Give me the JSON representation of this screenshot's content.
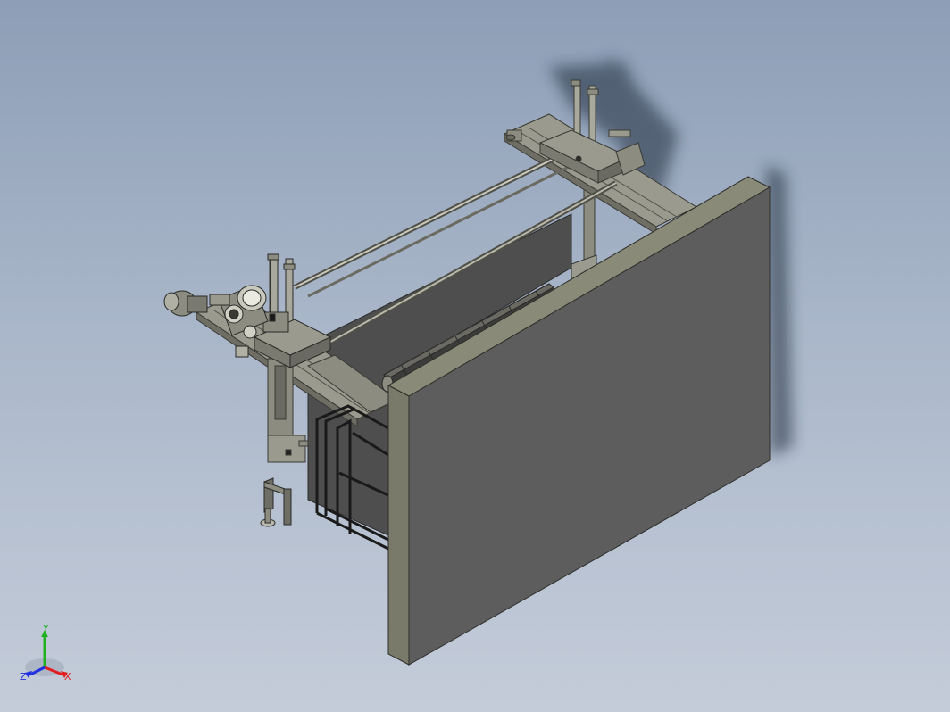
{
  "viewport": {
    "background_top": "#8d9eb6",
    "background_bottom": "#c4ccd9"
  },
  "model": {
    "panel_face_color": "#5d5d5d",
    "panel_edge_color": "#8a8a78",
    "frame_color": "#8c8c80",
    "shadow_color": "#1e2a3a"
  },
  "triad": {
    "x_label": "X",
    "y_label": "Y",
    "z_label": "Z",
    "x_color": "#e02020",
    "y_color": "#20b020",
    "z_color": "#2030e0"
  }
}
